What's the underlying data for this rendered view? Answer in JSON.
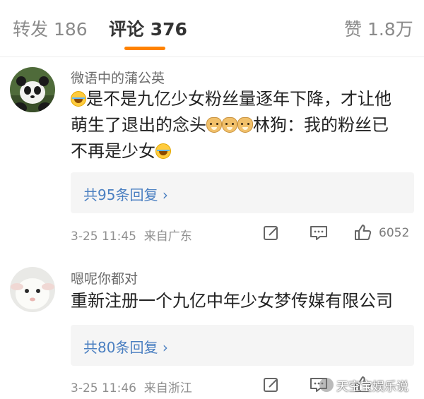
{
  "tabs": {
    "repost": "转发 186",
    "comment": "评论 376",
    "like": "赞 1.8万"
  },
  "colors": {
    "accent": "#ff8200",
    "link": "#4a7fc1",
    "reply_bg": "#f5f5f5"
  },
  "comments": [
    {
      "username": "微语中的蒲公英",
      "avatar_icon": "panda-avatar",
      "text_line1": "是不是九亿少女粉丝量逐年下降，才让他",
      "text_line2a": "萌生了退出的念头",
      "text_line2b": "林狗：我的粉丝已",
      "text_line3": "不再是少女",
      "replies": "共95条回复",
      "date": "3-25 11:45",
      "location": "来自广东",
      "likes": "6052"
    },
    {
      "username": "嗯呢你都对",
      "avatar_icon": "lamb-avatar",
      "text_line1": "重新注册一个九亿中年少女梦传媒有限公司",
      "replies": "共80条回复",
      "date": "3-25 11:46",
      "location": "来自浙江"
    }
  ],
  "watermark": "天空宝娱乐说"
}
